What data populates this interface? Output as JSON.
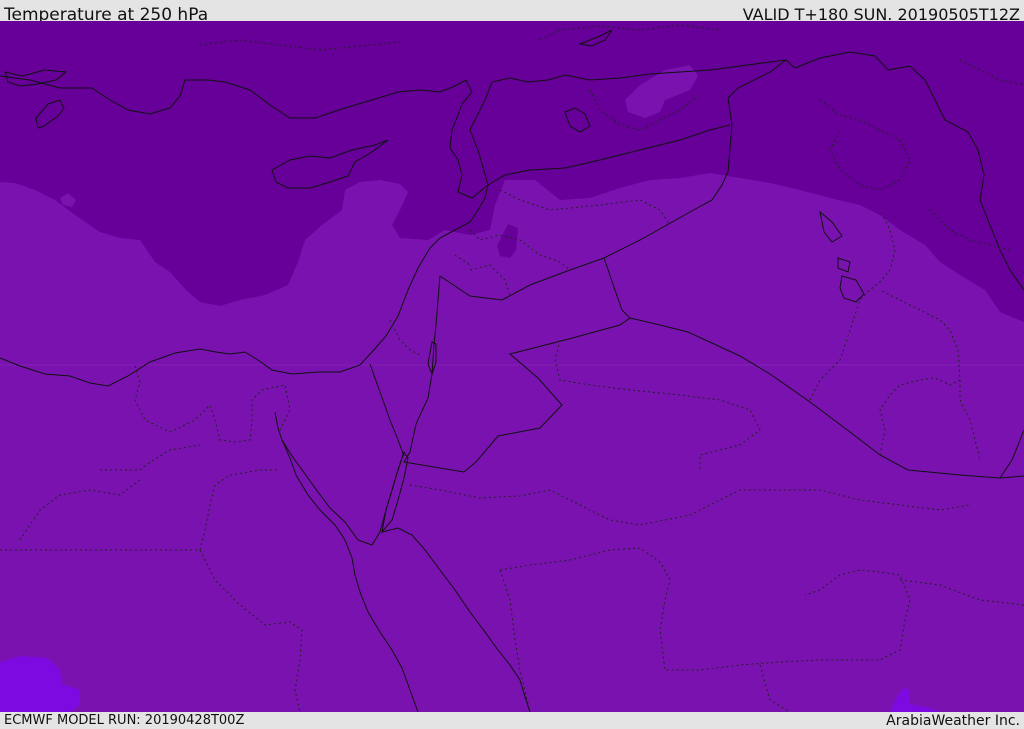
{
  "header": {
    "title": "Temperature at 250 hPa",
    "valid": "VALID T+180 SUN. 20190505T12Z"
  },
  "footer": {
    "model_run": "ECMWF MODEL RUN: 20190428T00Z",
    "credit": "ArabiaWeather Inc."
  },
  "colors": {
    "frame": "#e4e4e4",
    "colder_band": "#660099",
    "base_band": "#7a12b0",
    "coldest_pocket": "#7d0ae0",
    "text": "#111111"
  }
}
